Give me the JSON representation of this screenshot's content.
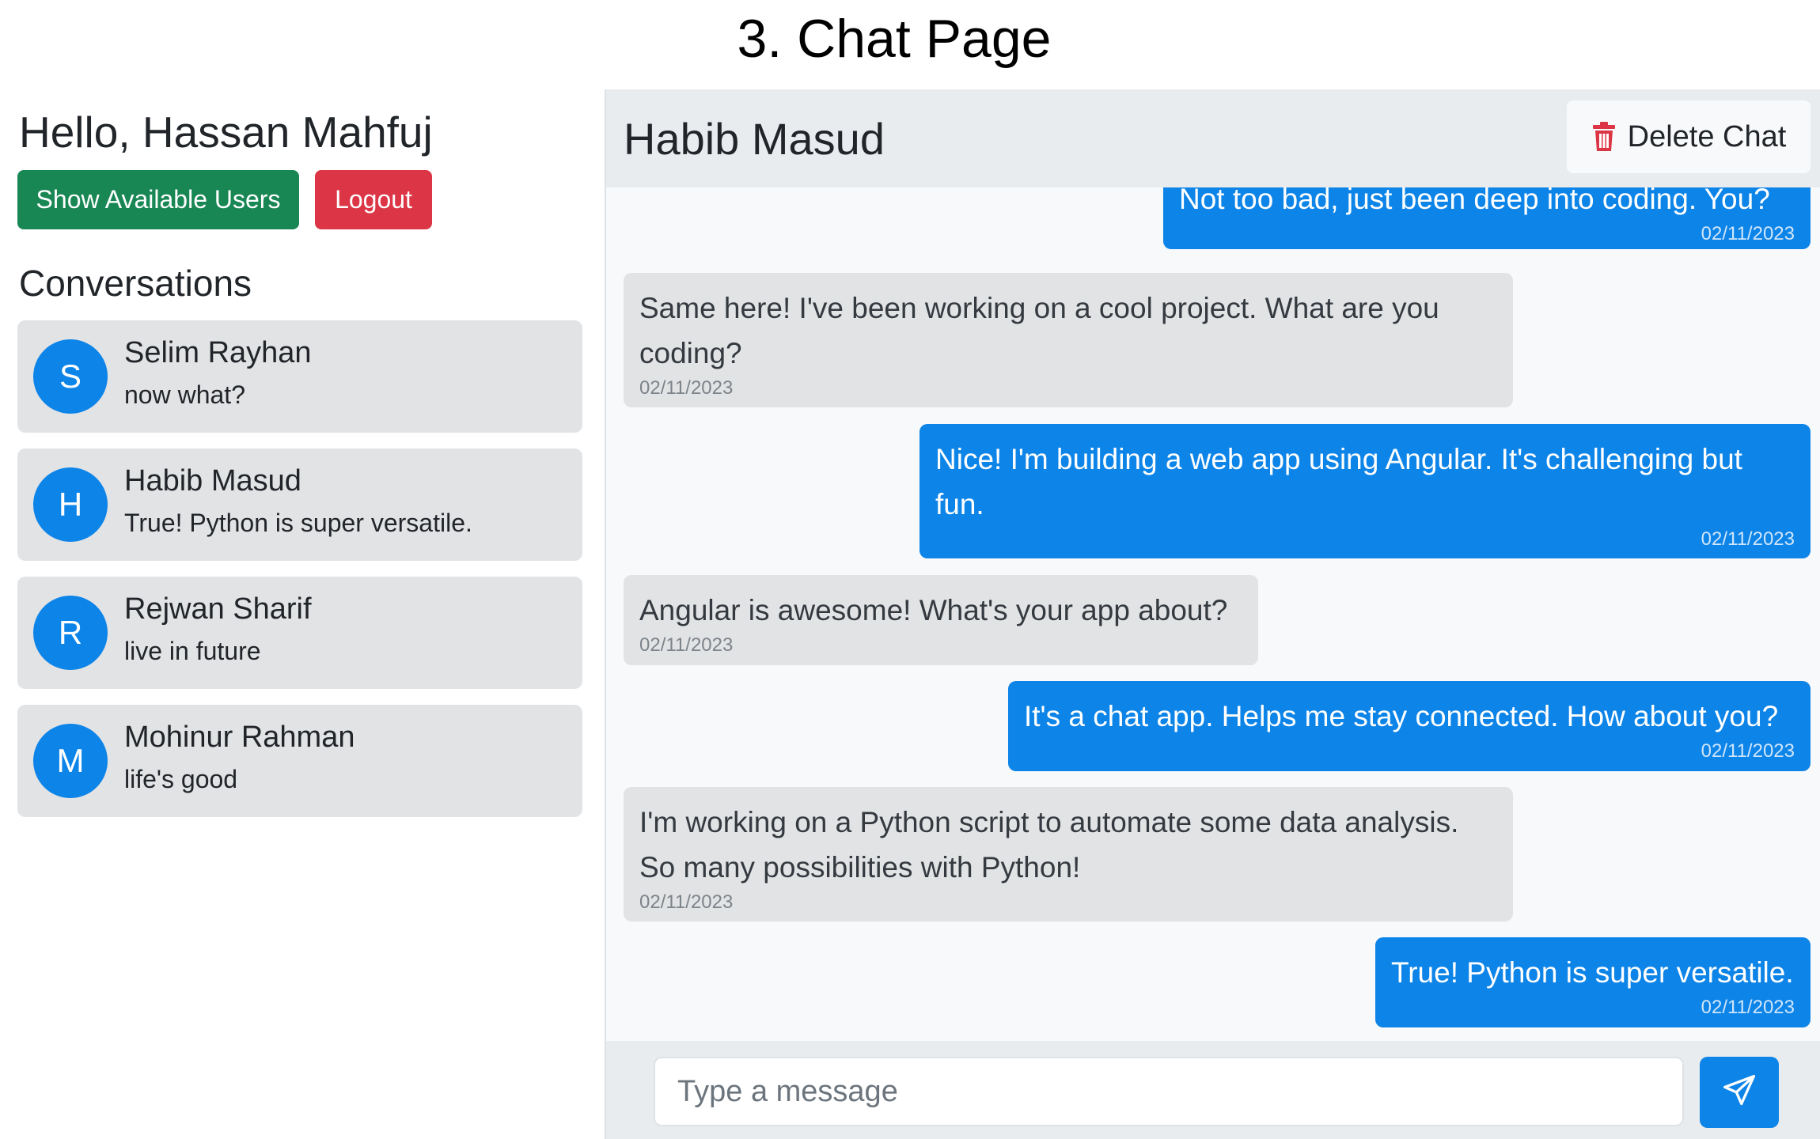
{
  "caption": "3. Chat Page",
  "sidebar": {
    "greeting": "Hello, Hassan Mahfuj",
    "show_users_label": "Show Available Users",
    "logout_label": "Logout",
    "conversations_heading": "Conversations",
    "conversations": [
      {
        "initial": "S",
        "name": "Selim Rayhan",
        "last_message": "now what?"
      },
      {
        "initial": "H",
        "name": "Habib Masud",
        "last_message": "True! Python is super versatile."
      },
      {
        "initial": "R",
        "name": "Rejwan Sharif",
        "last_message": "live in future"
      },
      {
        "initial": "M",
        "name": "Mohinur Rahman",
        "last_message": "life's good"
      }
    ]
  },
  "chat": {
    "title": "Habib Masud",
    "delete_label": "Delete Chat",
    "messages": [
      {
        "direction": "out",
        "text": "Not too bad, just been deep into coding. You?",
        "time": "02/11/2023"
      },
      {
        "direction": "in",
        "text": "Same here! I've been working on a cool project. What are you coding?",
        "time": "02/11/2023"
      },
      {
        "direction": "out",
        "text": "Nice! I'm building a web app using Angular. It's challenging but fun.",
        "time": "02/11/2023"
      },
      {
        "direction": "in",
        "text": "Angular is awesome! What's your app about?",
        "time": "02/11/2023"
      },
      {
        "direction": "out",
        "text": "It's a chat app. Helps me stay connected. How about you?",
        "time": "02/11/2023"
      },
      {
        "direction": "in",
        "text": "I'm working on a Python script to automate some data analysis. So many possibilities with Python!",
        "time": "02/11/2023"
      },
      {
        "direction": "out",
        "text": "True! Python is super versatile.",
        "time": "02/11/2023"
      }
    ],
    "input_placeholder": "Type a message",
    "input_value": ""
  },
  "colors": {
    "primary": "#0d84e8",
    "success": "#198754",
    "danger": "#dc3545",
    "bubble_in": "#e2e3e5"
  },
  "icons": {
    "delete": "trash-icon",
    "send": "send-icon"
  }
}
